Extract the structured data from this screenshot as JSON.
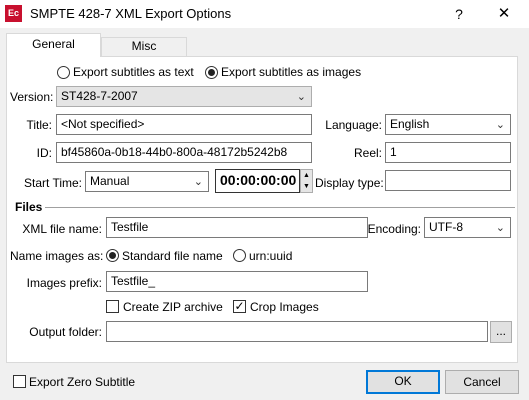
{
  "window": {
    "title": "SMPTE 428-7 XML Export Options",
    "icon_text": "Ec",
    "help_glyph": "?",
    "close_glyph": "✕"
  },
  "tabs": {
    "general": "General",
    "misc": "Misc"
  },
  "export_mode": {
    "as_text": "Export subtitles as text",
    "as_images": "Export subtitles as images",
    "selected": "as_images"
  },
  "version": {
    "label": "Version:",
    "value": "ST428-7-2007"
  },
  "title_field": {
    "label": "Title:",
    "value": "<Not specified>"
  },
  "language": {
    "label": "Language:",
    "value": "English"
  },
  "id_field": {
    "label": "ID:",
    "value": "bf45860a-0b18-44b0-800a-48172b5242b8"
  },
  "reel": {
    "label": "Reel:",
    "value": "1"
  },
  "start_time": {
    "label": "Start Time:",
    "mode": "Manual",
    "timecode": "00:00:00:00"
  },
  "display_type": {
    "label": "Display type:",
    "value": ""
  },
  "files": {
    "heading": "Files",
    "xml_file_name": {
      "label": "XML file name:",
      "value": "Testfile"
    },
    "encoding": {
      "label": "Encoding:",
      "value": "UTF-8"
    },
    "name_images_as": {
      "label": "Name images as:",
      "standard": "Standard file name",
      "uuid": "urn:uuid",
      "selected": "standard"
    },
    "images_prefix": {
      "label": "Images prefix:",
      "value": "Testfile_"
    },
    "create_zip": {
      "label": "Create ZIP archive",
      "checked": false
    },
    "crop_images": {
      "label": "Crop Images",
      "checked": true
    },
    "output_folder": {
      "label": "Output folder:",
      "value": "",
      "browse": "..."
    }
  },
  "footer": {
    "export_zero": {
      "label": "Export Zero Subtitle",
      "checked": false
    },
    "ok": "OK",
    "cancel": "Cancel"
  },
  "colors": {
    "accent": "#0078d7",
    "app_icon": "#c8102e"
  }
}
